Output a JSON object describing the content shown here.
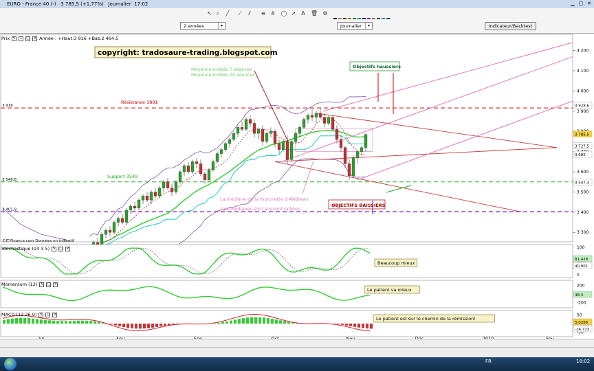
{
  "window": {
    "title": "EURO - France 40 (-)   3 785,5 (+1,77%)   Journalier  17:02"
  },
  "toolbar": {
    "period": "2 années",
    "interval": "Journalier",
    "indicators_button": "Indicateur/Backtest"
  },
  "palette": [
    "#000000",
    "#808080",
    "#800000",
    "#808000",
    "#008000",
    "#008080",
    "#000080",
    "#800080",
    "#808040",
    "#004040",
    "#0080ff",
    "#004080",
    "#ffffff",
    "#c0c0c0",
    "#ff0000",
    "#ffff00",
    "#00ff00",
    "#00ffff",
    "#0000ff",
    "#ff00ff",
    "#ffff80",
    "#00ff80",
    "#80ffff",
    "#8080ff"
  ],
  "price_panel": {
    "label": "Prix",
    "info": "Année : +Haut:3 916  +Bas:2 464,5",
    "copyright": "copyright: tradosaure-trading.blogspot.com",
    "source": "©IT-Finance.com  Données en indicatif",
    "resistance_label": "Résistance 3891",
    "resistance_value": "3 916",
    "support_label": "Support 3549",
    "support_value": "3 549,8",
    "lower_label": "3 401,9",
    "ma_label_1": "Moyenne mobile 7 séances",
    "ma_label_2": "Moyenne mobile 20 séances",
    "bull_target": "Objectifs haussiers",
    "bear_target": "OBJECTIFS BAISSIERS",
    "median_note_1": "La médiane de la fourchette d'ANdrews",
    "median_note_2": "Les médianes sont souvent ralliées",
    "right_labels": [
      "3 928,6",
      "3 785,5",
      "3 727,5",
      "3 685",
      "3 547,3"
    ],
    "axis_ticks": [
      "4 200",
      "4 100",
      "4 000",
      "3 900",
      "3 800",
      "3 700",
      "3 600",
      "3 500",
      "3 400",
      "3 300"
    ]
  },
  "stoch_panel": {
    "label": "Stochastique (14 3 5)",
    "note": "Beaucoup mieux",
    "right_values": [
      "81,428",
      "40,801"
    ],
    "axis_ticks": [
      "100",
      "50",
      "0"
    ]
  },
  "momentum_panel": {
    "label": "Momentum (12)",
    "note": "Le patient va mieux",
    "right_values": [
      "48,3"
    ],
    "axis_ticks": [
      "200",
      "0",
      "-200"
    ]
  },
  "macd_panel": {
    "label": "MACD (12 26 9)",
    "note": "Le patient est sur le chemin de la rémission!",
    "right_values": [
      "5,0286",
      "-24,723"
    ],
    "axis_ticks": [
      "50",
      "0",
      "-50"
    ]
  },
  "x_axis": {
    "labels": [
      "Jul",
      "Aou",
      "Sep",
      "Oct",
      "Nov",
      "Déc",
      "2010",
      "Fev"
    ]
  },
  "taskbar": {
    "lang": "FR",
    "time": "18:02"
  },
  "chart_data": {
    "type": "candlestick",
    "title": "EURO - France 40",
    "ylim": [
      3260,
      4260
    ],
    "x_labels": [
      "Jul",
      "Aou",
      "Sep",
      "Oct",
      "Nov",
      "Déc",
      "2010",
      "Fev"
    ],
    "candles": [
      [
        3180,
        3210,
        3160,
        3200
      ],
      [
        3200,
        3260,
        3190,
        3250
      ],
      [
        3250,
        3270,
        3210,
        3230
      ],
      [
        3230,
        3300,
        3220,
        3290
      ],
      [
        3290,
        3320,
        3270,
        3310
      ],
      [
        3310,
        3330,
        3280,
        3300
      ],
      [
        3300,
        3360,
        3290,
        3350
      ],
      [
        3350,
        3380,
        3330,
        3370
      ],
      [
        3370,
        3390,
        3340,
        3350
      ],
      [
        3350,
        3420,
        3340,
        3410
      ],
      [
        3410,
        3440,
        3390,
        3430
      ],
      [
        3430,
        3450,
        3400,
        3420
      ],
      [
        3420,
        3470,
        3410,
        3460
      ],
      [
        3460,
        3490,
        3440,
        3480
      ],
      [
        3480,
        3500,
        3450,
        3460
      ],
      [
        3460,
        3510,
        3440,
        3500
      ],
      [
        3500,
        3520,
        3470,
        3480
      ],
      [
        3480,
        3530,
        3470,
        3520
      ],
      [
        3520,
        3560,
        3500,
        3550
      ],
      [
        3550,
        3570,
        3510,
        3520
      ],
      [
        3520,
        3540,
        3480,
        3500
      ],
      [
        3500,
        3560,
        3490,
        3550
      ],
      [
        3550,
        3610,
        3540,
        3600
      ],
      [
        3600,
        3640,
        3580,
        3630
      ],
      [
        3630,
        3650,
        3590,
        3600
      ],
      [
        3600,
        3660,
        3590,
        3650
      ],
      [
        3650,
        3670,
        3620,
        3640
      ],
      [
        3640,
        3660,
        3580,
        3590
      ],
      [
        3590,
        3600,
        3540,
        3560
      ],
      [
        3560,
        3620,
        3550,
        3610
      ],
      [
        3610,
        3660,
        3600,
        3650
      ],
      [
        3650,
        3700,
        3640,
        3690
      ],
      [
        3690,
        3720,
        3670,
        3710
      ],
      [
        3710,
        3750,
        3700,
        3740
      ],
      [
        3740,
        3770,
        3720,
        3760
      ],
      [
        3760,
        3800,
        3750,
        3790
      ],
      [
        3790,
        3830,
        3770,
        3820
      ],
      [
        3820,
        3850,
        3800,
        3810
      ],
      [
        3810,
        3870,
        3800,
        3860
      ],
      [
        3860,
        3880,
        3820,
        3840
      ],
      [
        3840,
        3860,
        3770,
        3790
      ],
      [
        3790,
        3820,
        3760,
        3810
      ],
      [
        3810,
        3830,
        3730,
        3750
      ],
      [
        3750,
        3800,
        3740,
        3790
      ],
      [
        3790,
        3820,
        3770,
        3800
      ],
      [
        3800,
        3810,
        3720,
        3740
      ],
      [
        3740,
        3760,
        3690,
        3710
      ],
      [
        3710,
        3760,
        3700,
        3750
      ],
      [
        3750,
        3780,
        3640,
        3660
      ],
      [
        3660,
        3760,
        3650,
        3750
      ],
      [
        3750,
        3800,
        3740,
        3790
      ],
      [
        3790,
        3830,
        3770,
        3820
      ],
      [
        3820,
        3870,
        3810,
        3860
      ],
      [
        3860,
        3890,
        3840,
        3880
      ],
      [
        3880,
        3910,
        3850,
        3870
      ],
      [
        3870,
        3900,
        3840,
        3890
      ],
      [
        3890,
        3916,
        3860,
        3870
      ],
      [
        3870,
        3890,
        3820,
        3840
      ],
      [
        3840,
        3880,
        3830,
        3870
      ],
      [
        3870,
        3880,
        3800,
        3810
      ],
      [
        3810,
        3830,
        3740,
        3760
      ],
      [
        3760,
        3780,
        3700,
        3720
      ],
      [
        3720,
        3730,
        3620,
        3640
      ],
      [
        3640,
        3660,
        3560,
        3580
      ],
      [
        3580,
        3680,
        3570,
        3670
      ],
      [
        3670,
        3710,
        3640,
        3700
      ],
      [
        3700,
        3730,
        3680,
        3720
      ],
      [
        3720,
        3790,
        3700,
        3785
      ]
    ]
  }
}
